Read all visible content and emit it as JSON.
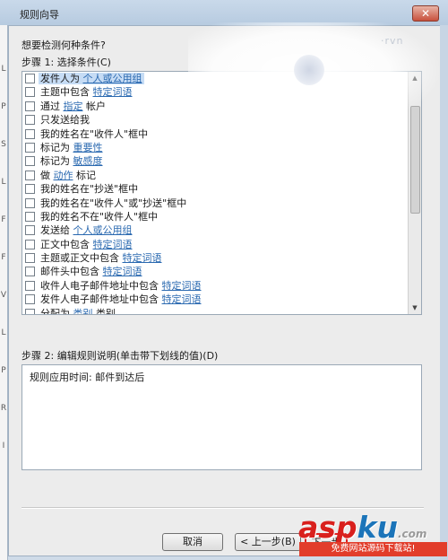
{
  "window": {
    "title": "规则向导",
    "close_label": "✕"
  },
  "left_strip_glyphs": [
    "L",
    "P",
    "S",
    "L",
    "F",
    "F",
    "V",
    "L",
    "P",
    "R",
    "I"
  ],
  "question": "想要检测何种条件?",
  "step1": {
    "label": "步骤 1: 选择条件(C)"
  },
  "conditions": [
    {
      "checked": false,
      "selected": true,
      "text": "发件人为",
      "link": "个人或公用组",
      "suffix": ""
    },
    {
      "checked": false,
      "text": "主题中包含",
      "link": "特定词语",
      "suffix": ""
    },
    {
      "checked": false,
      "text": "通过",
      "link": "指定",
      "suffix": "帐户"
    },
    {
      "checked": false,
      "text": "只发送给我",
      "link": "",
      "suffix": ""
    },
    {
      "checked": false,
      "text": "我的姓名在\"收件人\"框中",
      "link": "",
      "suffix": ""
    },
    {
      "checked": false,
      "text": "标记为",
      "link": "重要性",
      "suffix": ""
    },
    {
      "checked": false,
      "text": "标记为",
      "link": "敏感度",
      "suffix": ""
    },
    {
      "checked": false,
      "text": "做",
      "link": "动作",
      "suffix": "标记"
    },
    {
      "checked": false,
      "text": "我的姓名在\"抄送\"框中",
      "link": "",
      "suffix": ""
    },
    {
      "checked": false,
      "text": "我的姓名在\"收件人\"或\"抄送\"框中",
      "link": "",
      "suffix": ""
    },
    {
      "checked": false,
      "text": "我的姓名不在\"收件人\"框中",
      "link": "",
      "suffix": ""
    },
    {
      "checked": false,
      "text": "发送给",
      "link": "个人或公用组",
      "suffix": ""
    },
    {
      "checked": false,
      "text": "正文中包含",
      "link": "特定词语",
      "suffix": ""
    },
    {
      "checked": false,
      "text": "主题或正文中包含",
      "link": "特定词语",
      "suffix": ""
    },
    {
      "checked": false,
      "text": "邮件头中包含",
      "link": "特定词语",
      "suffix": ""
    },
    {
      "checked": false,
      "text": "收件人电子邮件地址中包含",
      "link": "特定词语",
      "suffix": ""
    },
    {
      "checked": false,
      "text": "发件人电子邮件地址中包含",
      "link": "特定词语",
      "suffix": ""
    },
    {
      "checked": false,
      "text": "分配为",
      "link": "类别",
      "suffix": "类别"
    }
  ],
  "scroll": {
    "up": "▲",
    "down": "▼"
  },
  "glare_mark": "·rvn",
  "step2": {
    "label": "步骤 2: 编辑规则说明(单击带下划线的值)(D)"
  },
  "description": "规则应用时间: 邮件到达后",
  "buttons": {
    "cancel": "取消",
    "back": "< 上一步(B)",
    "next": "下一步"
  },
  "watermark": {
    "main": "asp",
    "accent": "ku",
    "tail": ".com",
    "sub": "免费网站源码下载站!"
  }
}
